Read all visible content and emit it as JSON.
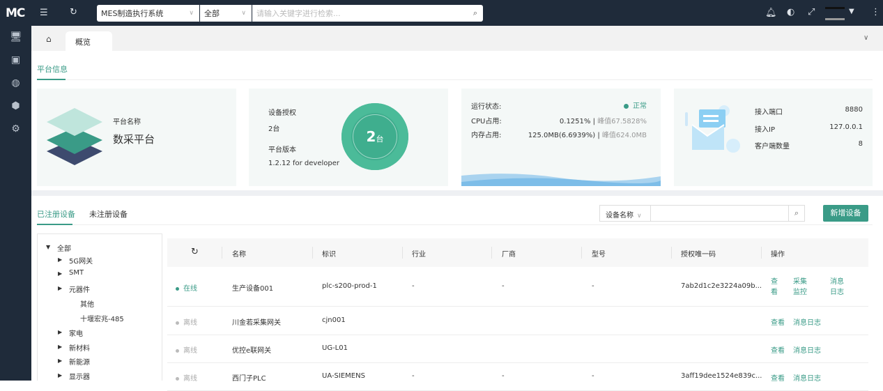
{
  "topbar": {
    "logo": "MC",
    "system_select": "MES制造执行系统",
    "scope_select": "全部",
    "search_placeholder": "请输入关键字进行检索..."
  },
  "tabs": {
    "home": "home",
    "current": "概览"
  },
  "platform": {
    "section_title": "平台信息",
    "name_label": "平台名称",
    "name_value": "数采平台",
    "license_label": "设备授权",
    "license_value": "2台",
    "version_label": "平台版本",
    "version_value": "1.2.12 for developer",
    "gauge_num": "2",
    "gauge_unit": "台",
    "status_label": "运行状态:",
    "status_value": "正常",
    "cpu_label": "CPU占用:",
    "cpu_value": "0.1251%",
    "cpu_peak": "峰值67.5828%",
    "mem_label": "内存占用:",
    "mem_value": "125.0MB(6.6939%)",
    "mem_peak": "峰值624.0MB",
    "sep": " | ",
    "port_label": "接入端口",
    "port_value": "8880",
    "ip_label": "接入IP",
    "ip_value": "127.0.0.1",
    "clients_label": "客户端数量",
    "clients_value": "8"
  },
  "devices": {
    "tab_registered": "已注册设备",
    "tab_unregistered": "未注册设备",
    "filter_select": "设备名称",
    "add_button": "新增设备",
    "tree": [
      "全部",
      "5G网关",
      "SMT",
      "元器件",
      "其他",
      "十堰宏兆-485",
      "家电",
      "新材料",
      "新能源",
      "显示器"
    ],
    "columns": [
      "名称",
      "标识",
      "行业",
      "厂商",
      "型号",
      "授权唯一码",
      "操作"
    ],
    "rows": [
      {
        "status": "在线",
        "name": "生产设备001",
        "id": "plc-s200-prod-1",
        "industry": "-",
        "vendor": "-",
        "model": "-",
        "code": "7ab2d1c2e3224a09b...",
        "actions": [
          "查看",
          "采集监控",
          "消息日志"
        ]
      },
      {
        "status": "离线",
        "name": "川金若采集网关",
        "id": "cjn001",
        "industry": "",
        "vendor": "",
        "model": "",
        "code": "",
        "actions": [
          "查看",
          "消息日志"
        ]
      },
      {
        "status": "离线",
        "name": "优控e联网关",
        "id": "UG-L01",
        "industry": "",
        "vendor": "",
        "model": "",
        "code": "",
        "actions": [
          "查看",
          "消息日志"
        ]
      },
      {
        "status": "离线",
        "name": "西门子PLC",
        "id": "UA-SIEMENS",
        "industry": "-",
        "vendor": "-",
        "model": "-",
        "code": "3aff19dee1524e839c...",
        "actions": [
          "查看",
          "消息日志"
        ]
      }
    ]
  },
  "colors": {
    "accent": "#3a9b87",
    "topbar": "#1f2b3a",
    "offline": "#aaaaaa"
  }
}
